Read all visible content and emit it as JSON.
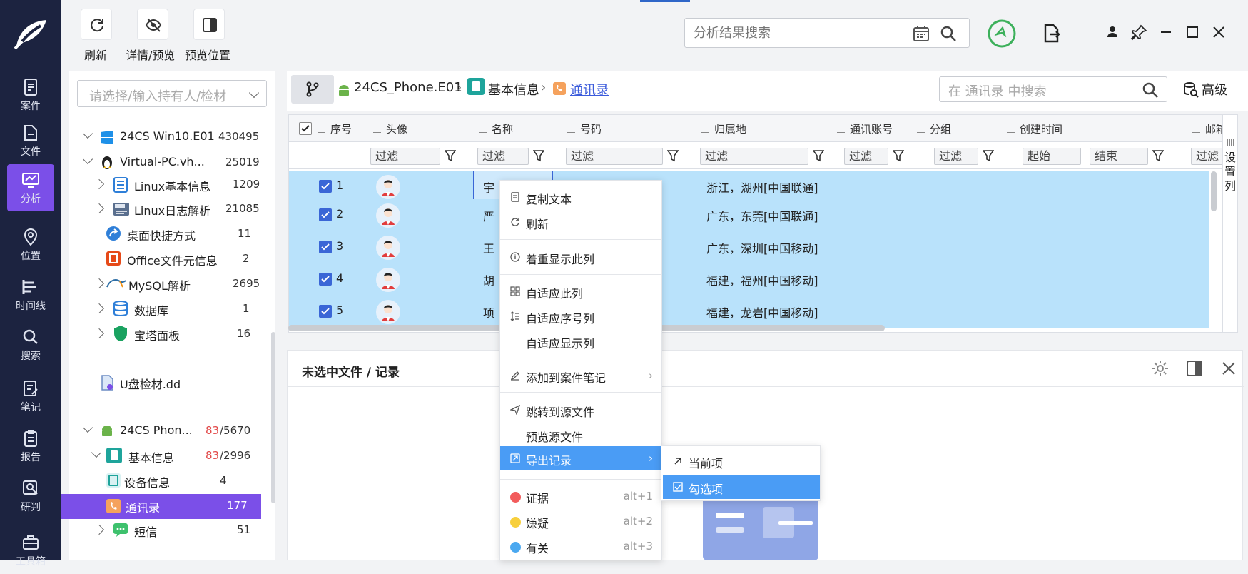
{
  "toolbar": {
    "refresh_label": "刷新",
    "detail_label": "详情/预览",
    "preview_pos_label": "预览位置"
  },
  "search": {
    "placeholder": "分析结果搜索"
  },
  "sidebar": {
    "items": [
      {
        "label": "案件",
        "icon": "case-icon"
      },
      {
        "label": "文件",
        "icon": "file-icon"
      },
      {
        "label": "分析",
        "icon": "analysis-icon",
        "active": true
      },
      {
        "label": "位置",
        "icon": "location-icon"
      },
      {
        "label": "时间线",
        "icon": "timeline-icon"
      },
      {
        "label": "搜索",
        "icon": "search-icon"
      },
      {
        "label": "笔记",
        "icon": "note-icon"
      },
      {
        "label": "报告",
        "icon": "report-icon"
      },
      {
        "label": "研判",
        "icon": "judge-icon"
      },
      {
        "label": "工具箱",
        "icon": "toolbox-icon"
      }
    ]
  },
  "tree": {
    "select_placeholder": "请选择/输入持有人/检材",
    "nodes": [
      {
        "label": "24CS Win10.E01",
        "count": "430495"
      },
      {
        "label": "Virtual-PC.vh...",
        "count": "25019"
      },
      {
        "label": "Linux基本信息",
        "count": "1209"
      },
      {
        "label": "Linux日志解析",
        "count": "21085"
      },
      {
        "label": "桌面快捷方式",
        "count": "11"
      },
      {
        "label": "Office文件元信息",
        "count": "2"
      },
      {
        "label": "MySQL解析",
        "count": "2695"
      },
      {
        "label": "数据库",
        "count": "1"
      },
      {
        "label": "宝塔面板",
        "count": "16"
      },
      {
        "label": "U盘检材.dd",
        "count": ""
      },
      {
        "label": "24CS Phon...",
        "count_red": "83",
        "count": "/5670"
      },
      {
        "label": "基本信息",
        "count_red": "83",
        "count": "/2996"
      },
      {
        "label": "设备信息",
        "count": "4"
      },
      {
        "label": "通讯录",
        "count": "177"
      },
      {
        "label": "短信",
        "count": "51"
      }
    ]
  },
  "breadcrumb": {
    "items": [
      "24CS_Phone.E01",
      "基本信息",
      "通讯录"
    ],
    "search_placeholder": "在 通讯录 中搜索",
    "advanced": "高级"
  },
  "grid": {
    "columns": [
      "序号",
      "头像",
      "名称",
      "号码",
      "归属地",
      "通讯账号",
      "分组",
      "创建时间",
      "邮箱"
    ],
    "filter_text": "过滤",
    "filter_start": "起始",
    "filter_end": "结束",
    "set_columns": "设置列",
    "rows": [
      {
        "num": "1",
        "name": "宇",
        "location": "浙江，湖州[中国联通]"
      },
      {
        "num": "2",
        "name": "严",
        "location": "广东，东莞[中国联通]"
      },
      {
        "num": "3",
        "name": "王",
        "location": "广东，深圳[中国移动]"
      },
      {
        "num": "4",
        "name": "胡",
        "location": "福建，福州[中国移动]"
      },
      {
        "num": "5",
        "name": "项",
        "location": "福建，龙岩[中国移动]"
      }
    ]
  },
  "detail": {
    "title": "未选中文件 / 记录"
  },
  "context_menu": {
    "items": [
      "复制文本",
      "刷新",
      "着重显示此列",
      "自适应此列",
      "自适应序号列",
      "自适应显示列",
      "添加到案件笔记",
      "跳转到源文件",
      "预览源文件",
      "导出记录",
      "证据",
      "嫌疑",
      "有关"
    ],
    "shortcuts": [
      "alt+1",
      "alt+2",
      "alt+3"
    ],
    "tag_colors": [
      "#f25b5b",
      "#f7cf3c",
      "#4aa8f0"
    ],
    "submenu": [
      "当前项",
      "勾选项"
    ]
  },
  "colors": {
    "sidebar_bg": "#1c2340",
    "active": "#7b4fe8",
    "selection_row": "#b9e2fb",
    "menu_highlight": "#4a9cf5"
  }
}
